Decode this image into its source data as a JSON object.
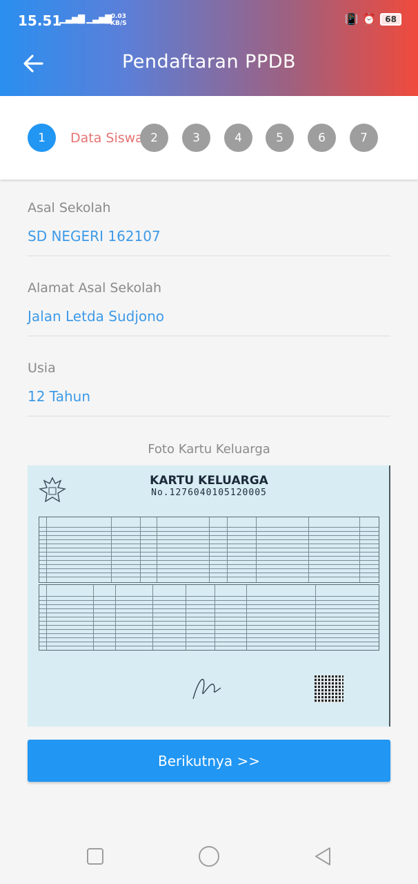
{
  "status_bar": {
    "time": "15.51",
    "signal": "▁▃▅▇ ▁▃▅▇",
    "net_speed_value": "0.03",
    "net_speed_unit": "KB/S",
    "battery": "68"
  },
  "appbar": {
    "title": "Pendaftaran PPDB",
    "back_icon": "arrow-left-icon"
  },
  "stepper": {
    "active_label": "Data Siswa",
    "steps": [
      "1",
      "2",
      "3",
      "4",
      "5",
      "6",
      "7"
    ],
    "active_color": "#2196f3",
    "inactive_color": "#9e9e9e"
  },
  "fields": [
    {
      "label": "Asal Sekolah",
      "value": "SD NEGERI 162107"
    },
    {
      "label": "Alamat Asal Sekolah",
      "value": "Jalan Letda Sudjono"
    },
    {
      "label": "Usia",
      "value": "12 Tahun"
    }
  ],
  "photo": {
    "title": "Foto Kartu Keluarga",
    "card_heading": "KARTU KELUARGA",
    "card_number": "No.1276040105120005"
  },
  "next_button": "Berikutnya >>",
  "colors": {
    "accent": "#2196f3",
    "value_text": "#3d9ae8",
    "step_label": "#e57373"
  }
}
